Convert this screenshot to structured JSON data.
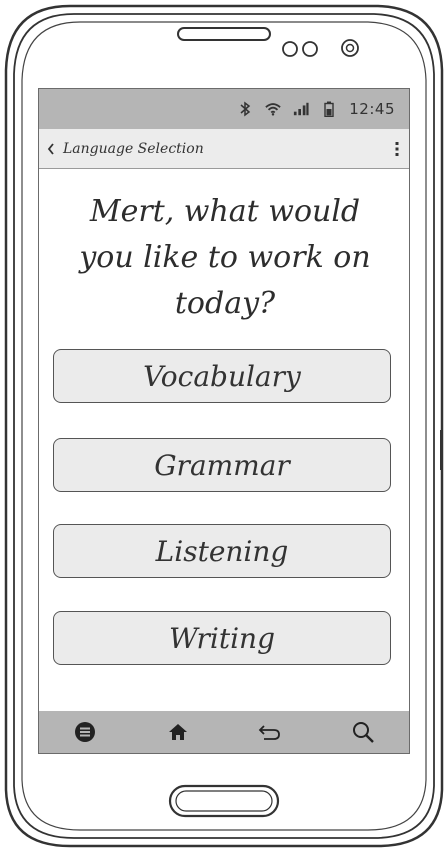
{
  "status_bar": {
    "icons": [
      "bluetooth-icon",
      "wifi-icon",
      "signal-icon",
      "battery-icon"
    ],
    "time": "12:45"
  },
  "title_bar": {
    "back_icon": "chevron-left-icon",
    "title": "Language Selection",
    "overflow_icon": "more-vertical-icon"
  },
  "question": "Mert, what would\nyou like to work on\ntoday?",
  "options": [
    {
      "label": "Vocabulary"
    },
    {
      "label": "Grammar"
    },
    {
      "label": "Listening"
    },
    {
      "label": "Writing"
    }
  ],
  "nav_bar": {
    "icons": [
      "menu-icon",
      "home-icon",
      "back-icon",
      "search-icon"
    ]
  },
  "colors": {
    "status_bar_bg": "#b5b5b5",
    "title_bar_bg": "#ececec",
    "option_bg": "#ebebeb",
    "outline": "#555555"
  }
}
